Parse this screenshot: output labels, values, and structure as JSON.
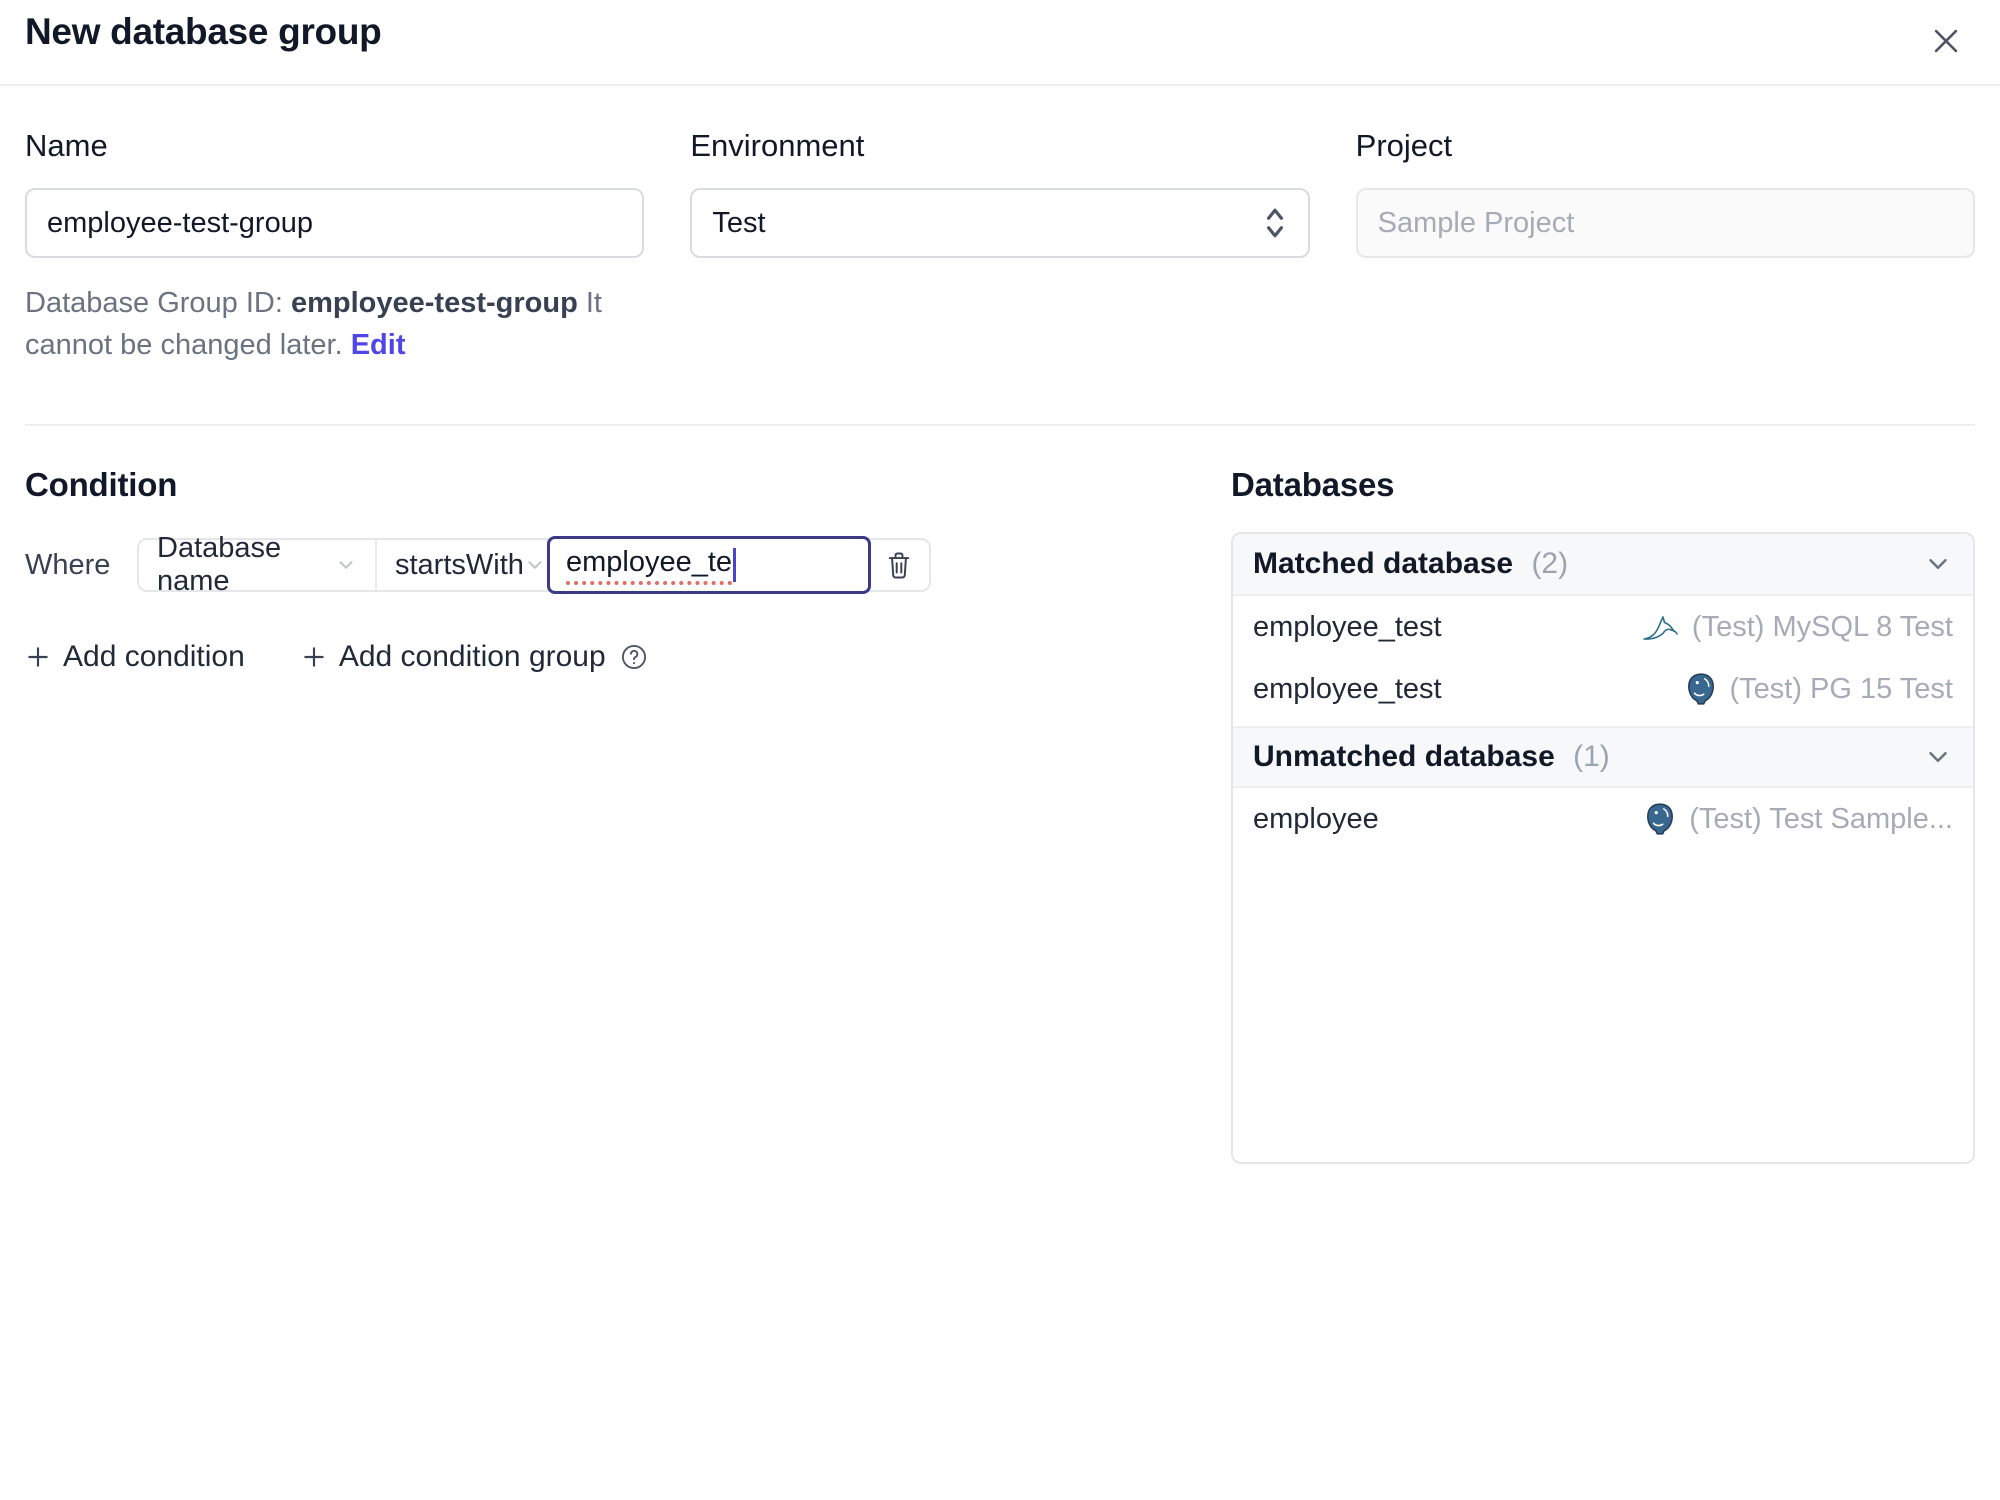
{
  "dialog": {
    "title": "New database group"
  },
  "form": {
    "name": {
      "label": "Name",
      "value": "employee-test-group"
    },
    "environment": {
      "label": "Environment",
      "value": "Test"
    },
    "project": {
      "label": "Project",
      "value": "Sample Project"
    },
    "group_id_note": {
      "prefix": "Database Group ID: ",
      "id": "employee-test-group",
      "suffix": " It cannot be changed later. ",
      "edit_label": "Edit"
    }
  },
  "condition": {
    "heading": "Condition",
    "where_label": "Where",
    "field_selector": "Database name",
    "operator_selector": "startsWith",
    "value_input": "employee_te",
    "add_condition_label": "Add condition",
    "add_condition_group_label": "Add condition group"
  },
  "databases": {
    "heading": "Databases",
    "matched": {
      "title": "Matched database",
      "count": "(2)",
      "rows": [
        {
          "name": "employee_test",
          "instance": "(Test) MySQL 8 Test",
          "engine": "mysql"
        },
        {
          "name": "employee_test",
          "instance": "(Test) PG 15 Test",
          "engine": "postgres"
        }
      ]
    },
    "unmatched": {
      "title": "Unmatched database",
      "count": "(1)",
      "rows": [
        {
          "name": "employee",
          "instance": "(Test) Test Sample...",
          "engine": "postgres"
        }
      ]
    }
  },
  "colors": {
    "accent": "#4f46e5",
    "focus_border": "#3d3a85",
    "spellcheck_red": "#e06c66",
    "mysql_teal": "#2e6f8e",
    "postgres_blue": "#38678f",
    "header_bg": "#f7f8f9"
  }
}
